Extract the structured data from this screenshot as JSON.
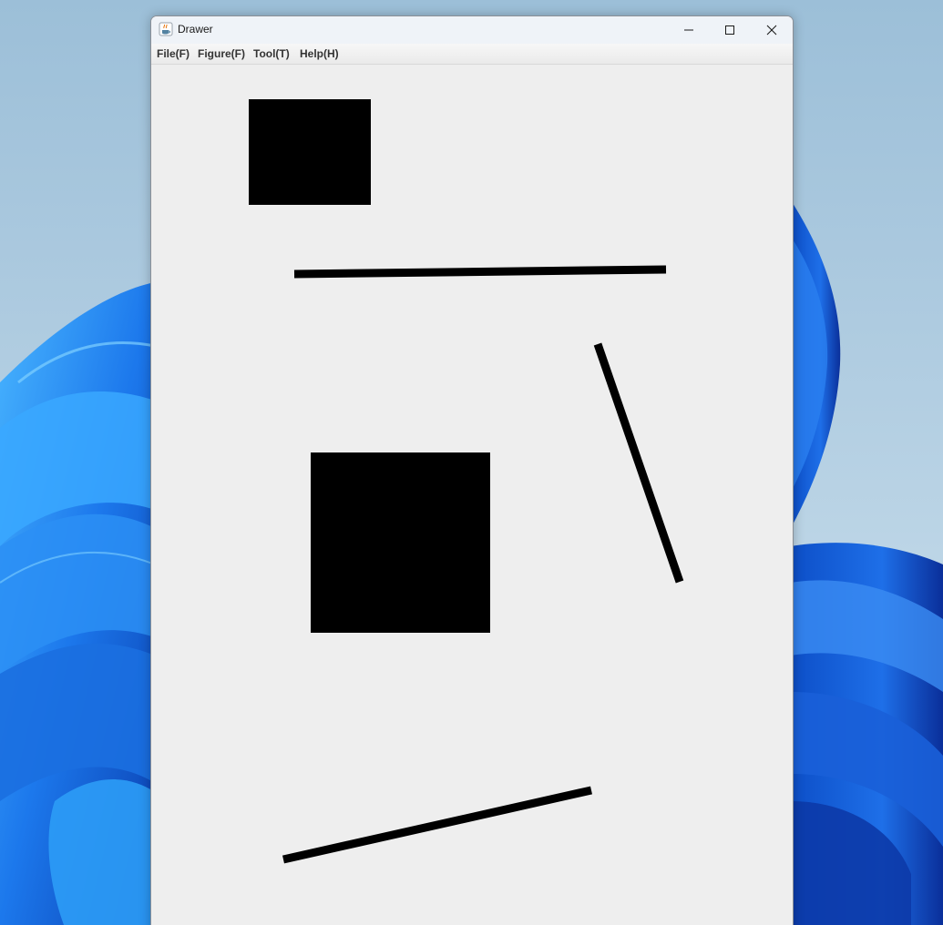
{
  "window": {
    "title": "Drawer"
  },
  "icons": {
    "app": "java-coffee-icon",
    "minimize": "minimize-icon",
    "maximize": "maximize-icon",
    "close": "close-icon"
  },
  "menu": {
    "file": "File(F)",
    "figure": "Figure(F)",
    "tool": "Tool(T)",
    "help": "Help(H)"
  },
  "canvas": {
    "background_color": "#eeeeee",
    "shape_color": "#000000",
    "shape_types": [
      "filled-rectangle",
      "line",
      "line",
      "filled-rectangle",
      "line"
    ]
  },
  "colors": {
    "titlebar": "#eff3f8",
    "wallpaper_accent": "#1a6fe0"
  }
}
